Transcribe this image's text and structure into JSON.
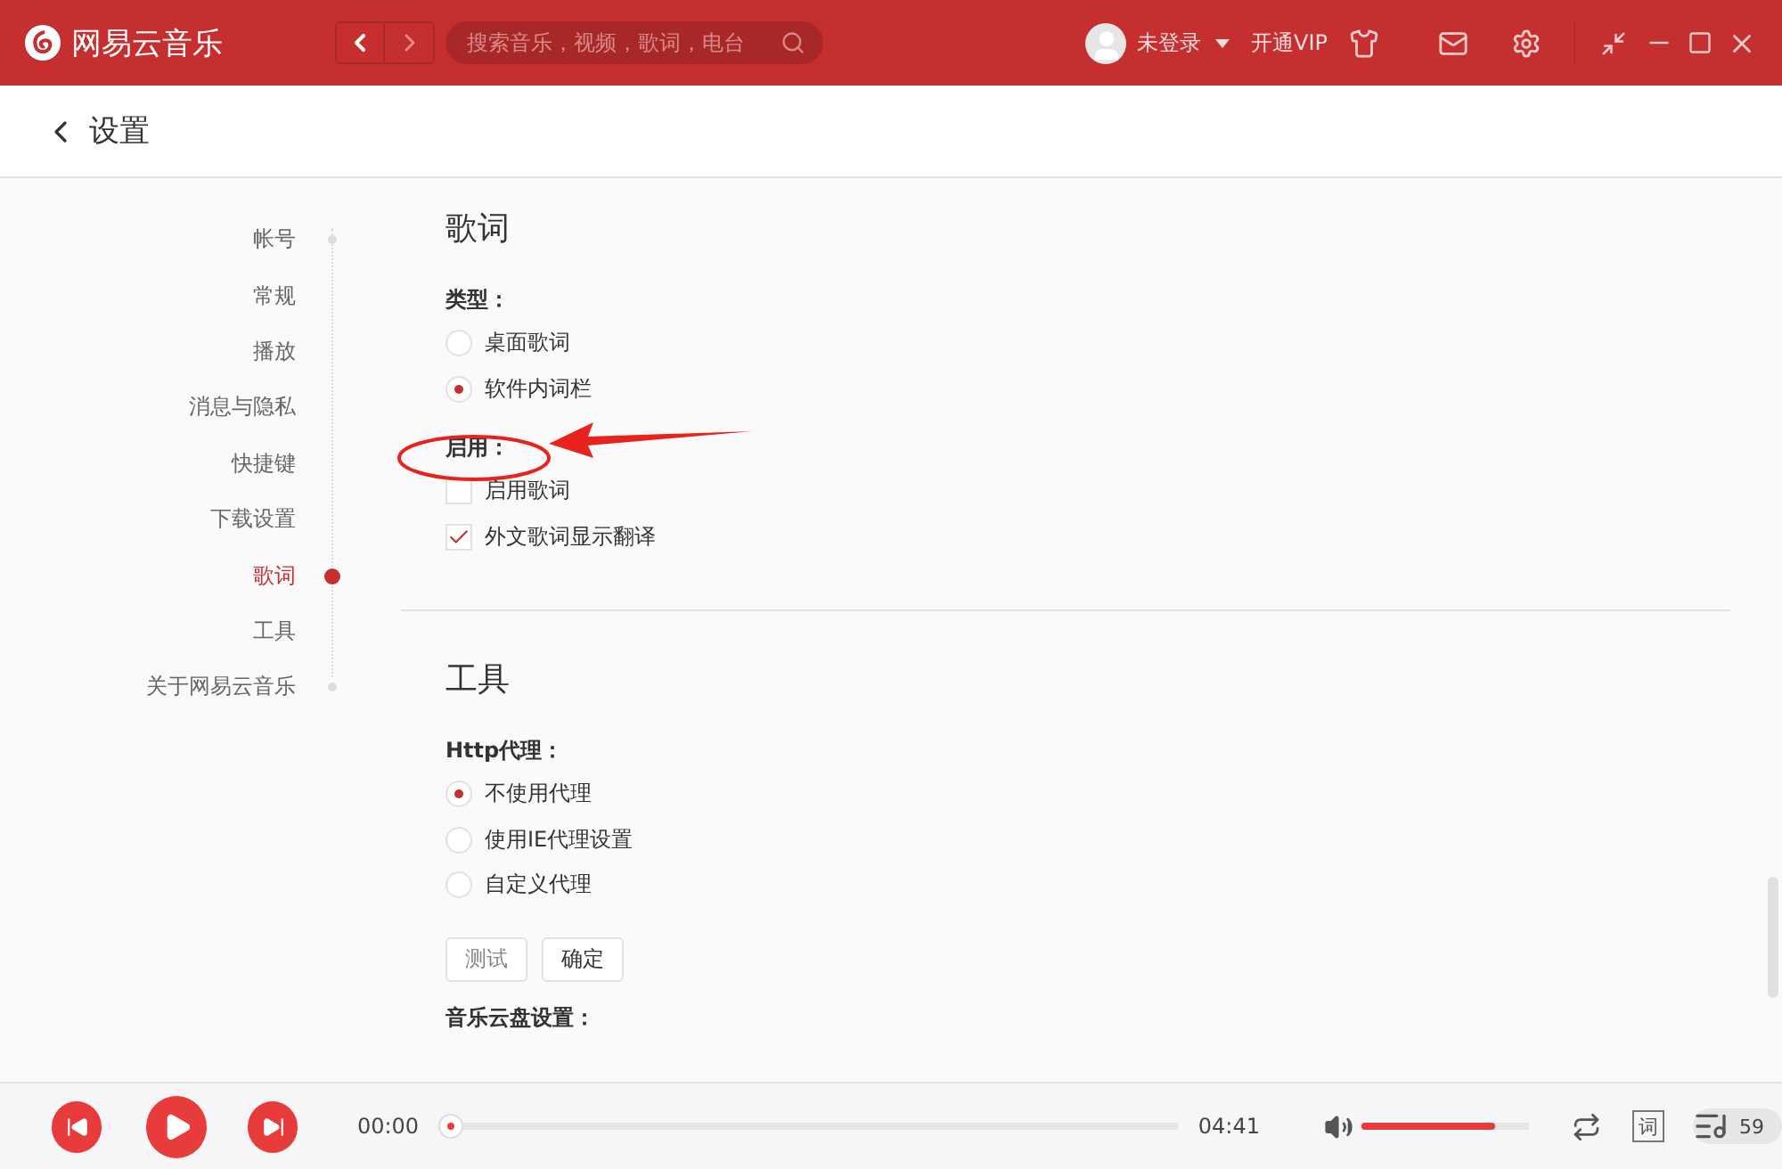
{
  "header": {
    "app_name": "网易云音乐",
    "search": {
      "placeholder": "搜索音乐，视频，歌词，电台"
    },
    "user": "未登录",
    "vip": "开通VIP"
  },
  "page_title": "设置",
  "nav": [
    {
      "label": "帐号",
      "selected": false
    },
    {
      "label": "常规",
      "selected": false
    },
    {
      "label": "播放",
      "selected": false
    },
    {
      "label": "消息与隐私",
      "selected": false
    },
    {
      "label": "快捷键",
      "selected": false
    },
    {
      "label": "下载设置",
      "selected": false
    },
    {
      "label": "歌词",
      "selected": true
    },
    {
      "label": "工具",
      "selected": false
    },
    {
      "label": "关于网易云音乐",
      "selected": false
    }
  ],
  "sections": [
    {
      "title": "歌词",
      "groups": [
        {
          "label": "类型：",
          "kind": "radio",
          "options": [
            {
              "label": "桌面歌词",
              "selected": false
            },
            {
              "label": "软件内词栏",
              "selected": true
            }
          ]
        },
        {
          "label": "启用：",
          "kind": "checkbox",
          "options": [
            {
              "label": "启用歌词",
              "checked": false
            },
            {
              "label": "外文歌词显示翻译",
              "checked": true
            }
          ]
        }
      ]
    },
    {
      "title": "工具",
      "groups": [
        {
          "label": "Http代理：",
          "kind": "radio",
          "options": [
            {
              "label": "不使用代理",
              "selected": true
            },
            {
              "label": "使用IE代理设置",
              "selected": false
            },
            {
              "label": "自定义代理",
              "selected": false
            }
          ],
          "buttons": [
            "测试",
            "确定"
          ]
        },
        {
          "label": "音乐云盘设置："
        }
      ]
    }
  ],
  "player": {
    "current_time": "00:00",
    "total_time": "04:41",
    "progress": {
      "level": 0
    },
    "volume": {
      "level": 0.8
    },
    "lyric_button": "词",
    "playlist_count": "59"
  }
}
